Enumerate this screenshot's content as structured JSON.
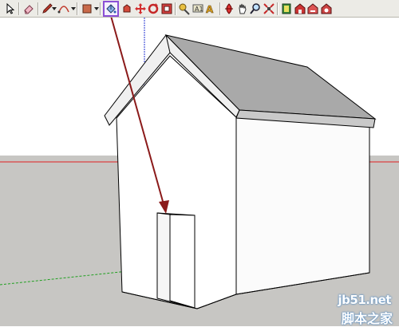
{
  "toolbar": {
    "tools": [
      {
        "name": "select-tool",
        "icon": "arrow-cursor-icon"
      },
      {
        "name": "eraser-tool",
        "icon": "eraser-icon"
      },
      {
        "name": "pencil-line-tool",
        "icon": "pencil-icon"
      },
      {
        "name": "arc-tool",
        "icon": "arc-icon"
      },
      {
        "name": "rectangle-tool",
        "icon": "rectangle-icon"
      },
      {
        "name": "paint-bucket-tool",
        "icon": "paint-bucket-icon",
        "active": true
      },
      {
        "name": "push-pull-tool",
        "icon": "push-pull-icon"
      },
      {
        "name": "move-tool",
        "icon": "move-icon"
      },
      {
        "name": "rotate-tool",
        "icon": "rotate-icon"
      },
      {
        "name": "offset-tool",
        "icon": "offset-icon"
      },
      {
        "name": "tape-measure-tool",
        "icon": "tape-measure-icon"
      },
      {
        "name": "text-tool",
        "icon": "text-icon"
      },
      {
        "name": "paint-tool",
        "icon": "paint-icon"
      },
      {
        "name": "orbit-tool",
        "icon": "orbit-icon"
      },
      {
        "name": "pan-tool",
        "icon": "pan-icon"
      },
      {
        "name": "zoom-tool",
        "icon": "zoom-icon"
      },
      {
        "name": "zoom-extents-tool",
        "icon": "zoom-extents-icon"
      },
      {
        "name": "components-tool",
        "icon": "components-icon"
      },
      {
        "name": "warehouse-tool",
        "icon": "warehouse-icon"
      },
      {
        "name": "share-model-tool",
        "icon": "share-model-icon"
      },
      {
        "name": "extension-tool",
        "icon": "extension-icon"
      }
    ]
  },
  "colors": {
    "sky": "#ffffff",
    "ground": "#c7c6c3",
    "roof": "#a9a9a9",
    "wall_front": "#ffffff",
    "wall_side": "#fbfbfb",
    "axis_red": "#e02020",
    "axis_blue": "#2030d0",
    "axis_green": "#20a020",
    "pointer_arrow": "#8b1a1a",
    "highlight": "#8b4fd6"
  },
  "watermark": {
    "url": "jb51.net",
    "site": "脚本之家"
  }
}
